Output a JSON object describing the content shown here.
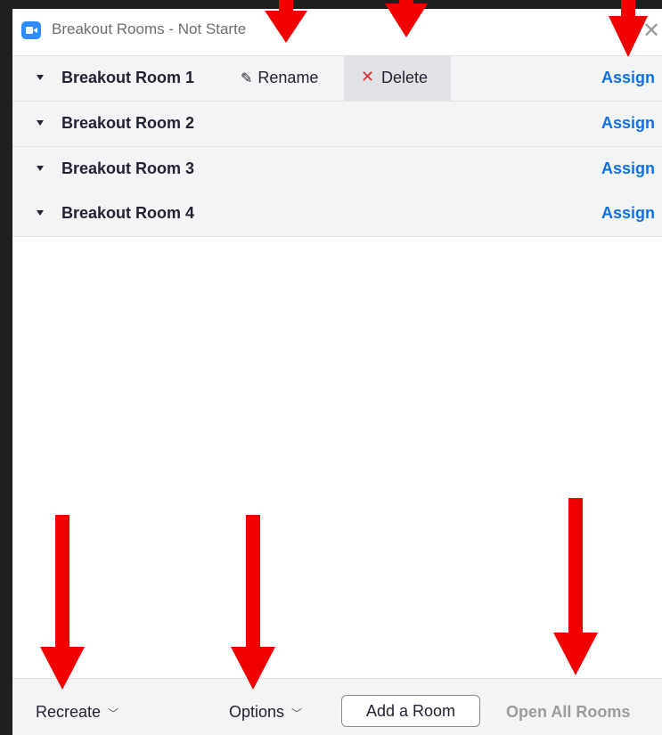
{
  "window": {
    "title": "Breakout Rooms - Not Starte"
  },
  "rooms": [
    {
      "name": "Breakout Room 1",
      "assign": "Assign",
      "rename": "Rename",
      "delete": "Delete"
    },
    {
      "name": "Breakout Room 2",
      "assign": "Assign"
    },
    {
      "name": "Breakout Room 3",
      "assign": "Assign"
    },
    {
      "name": "Breakout Room 4",
      "assign": "Assign"
    }
  ],
  "footer": {
    "recreate": "Recreate",
    "options": "Options",
    "add_room": "Add a Room",
    "open_all": "Open All Rooms"
  },
  "icons": {
    "app": "zoom-camera-icon",
    "close": "close-icon",
    "caret": "caret-down-icon",
    "rename": "pencil-icon",
    "delete": "x-icon",
    "chevron": "chevron-down-icon"
  },
  "colors": {
    "accent": "#0e71eb",
    "annotation": "#f00000",
    "delete": "#e02828",
    "row_bg": "#f3f4f6"
  }
}
